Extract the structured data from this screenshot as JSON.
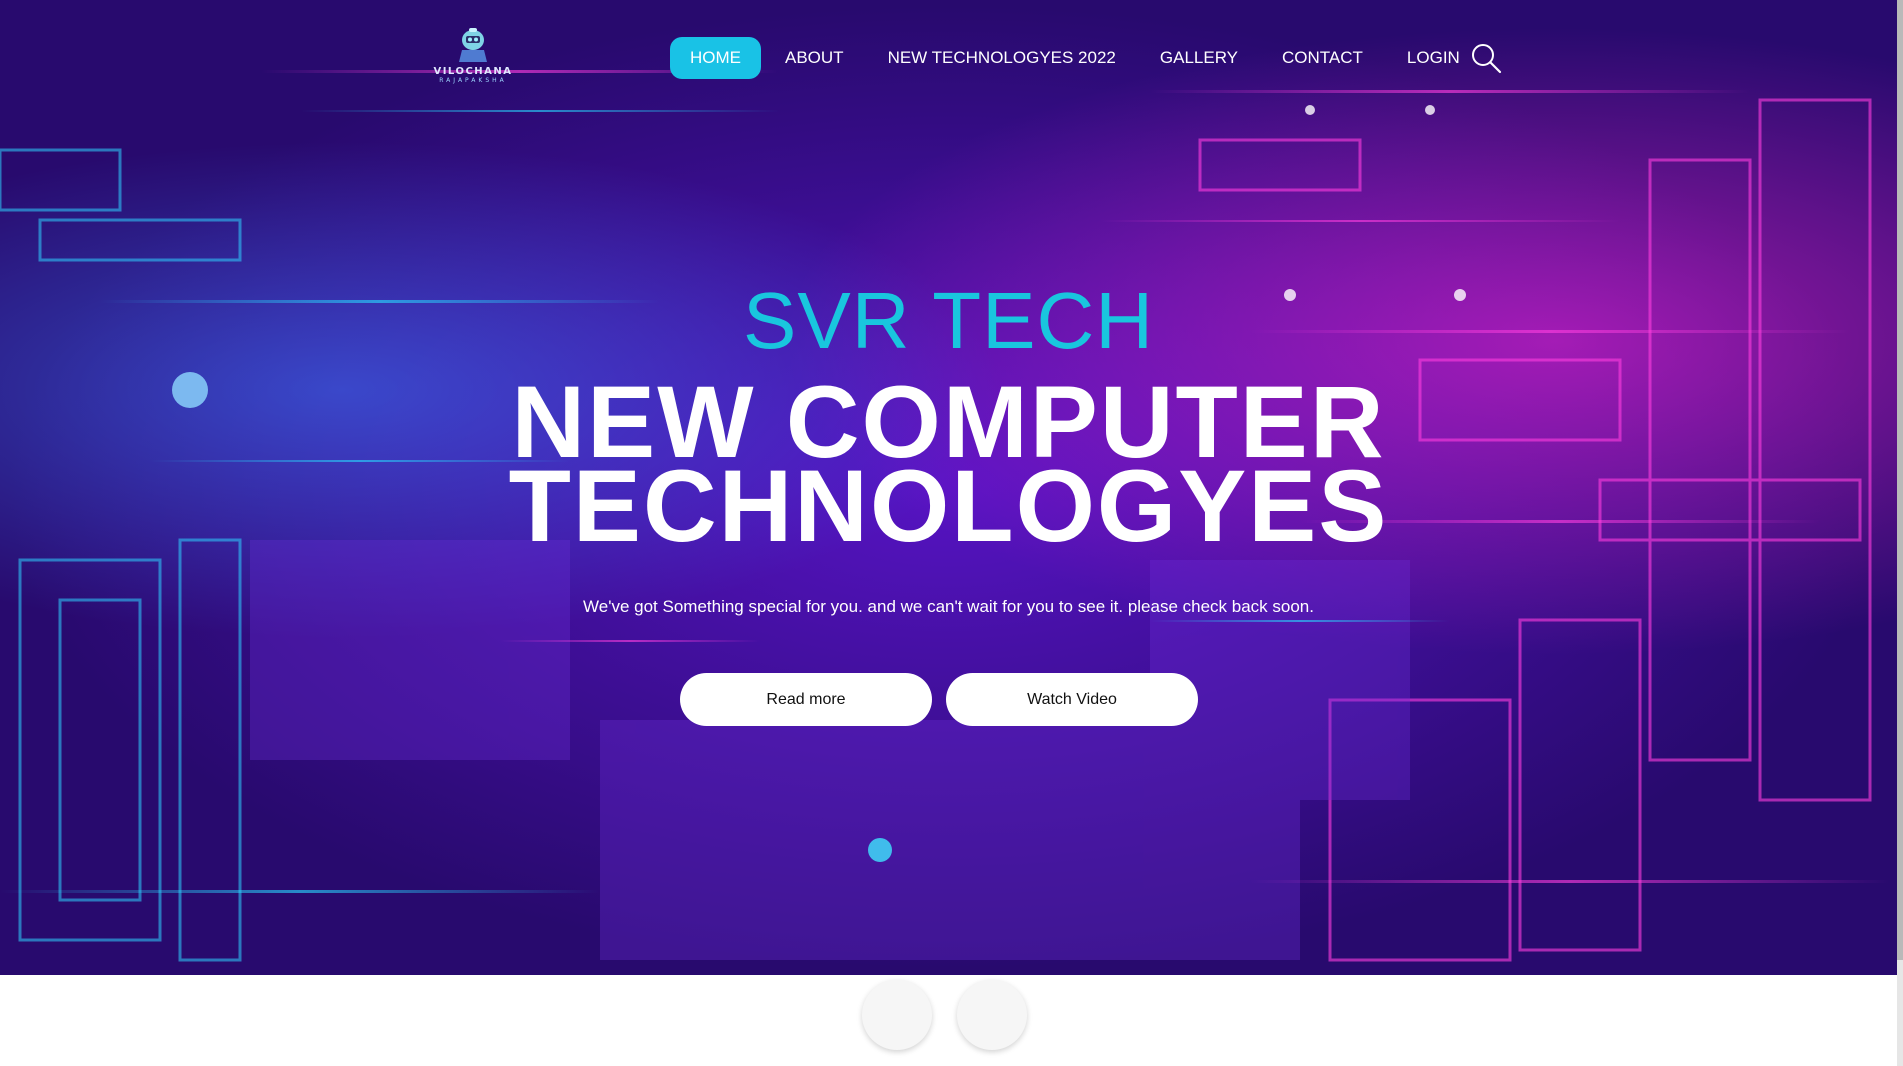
{
  "logo": {
    "name": "VILOCHANA",
    "sub": "RAJAPAKSHA",
    "icon": "robot-mascot-icon"
  },
  "nav": {
    "items": [
      {
        "label": "HOME",
        "active": true
      },
      {
        "label": "ABOUT",
        "active": false
      },
      {
        "label": "NEW TECHNOLOGYES 2022",
        "active": false
      },
      {
        "label": "GALLERY",
        "active": false
      },
      {
        "label": "CONTACT",
        "active": false
      },
      {
        "label": "LOGIN",
        "active": false
      }
    ],
    "search_icon": "search-icon"
  },
  "hero": {
    "brand": "SVR TECH",
    "headline_line1": "NEW COMPUTER",
    "headline_line2": "TECHNOLOGYES",
    "tagline": "We've got Something special for you. and we can't wait for you to see it. please check back soon.",
    "read_more_label": "Read more",
    "watch_video_label": "Watch Video"
  },
  "colors": {
    "accent": "#19c2e6",
    "brand_text": "#19c6de",
    "button_bg": "#ffffff"
  }
}
